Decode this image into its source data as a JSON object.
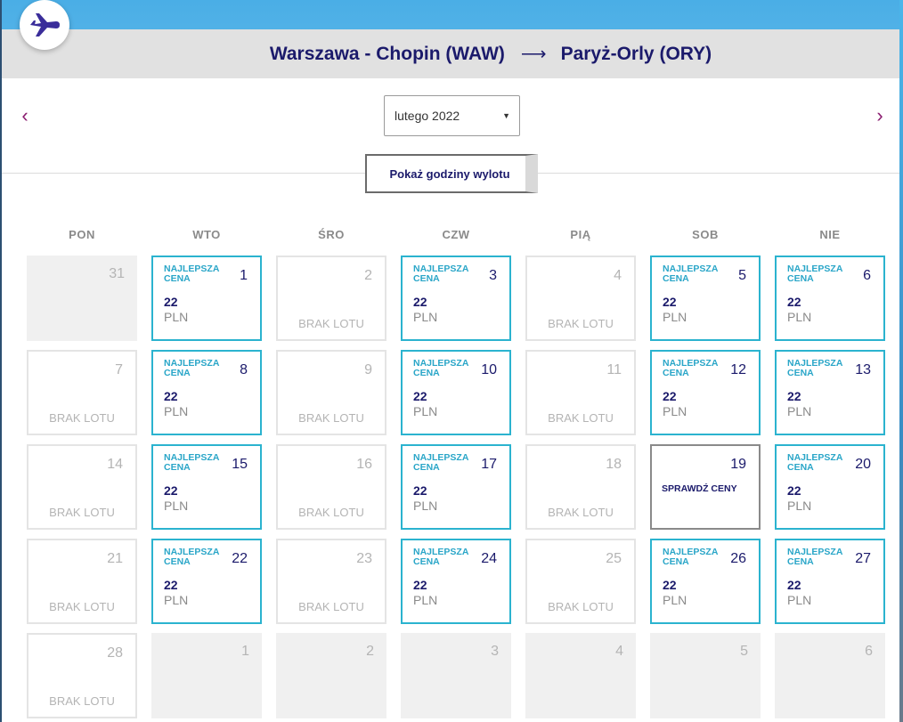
{
  "route": {
    "from": "Warszawa - Chopin (WAW)",
    "arrow": "⟶",
    "to": "Paryż-Orly (ORY)"
  },
  "nav": {
    "prev_icon": "chevron-left-icon",
    "next_icon": "chevron-right-icon",
    "prev_glyph": "‹",
    "next_glyph": "›"
  },
  "month_select": {
    "value": "lutego 2022",
    "caret": "▼"
  },
  "show_times_button": "Pokaż godziny wylotu",
  "weekdays": [
    "PON",
    "WTO",
    "ŚRO",
    "CZW",
    "PIĄ",
    "SOB",
    "NIE"
  ],
  "labels": {
    "best": "NAJLEPSZA CENA",
    "no_flight": "BRAK LOTU",
    "check_prices": "SPRAWDŹ CENY"
  },
  "colors": {
    "brand": "#1b1a6b",
    "best_border": "#2bb3cf",
    "nav_arrow": "#8a1c6f"
  },
  "days": [
    {
      "day": "31",
      "state": "past"
    },
    {
      "day": "1",
      "state": "best",
      "price": "22",
      "currency": "PLN"
    },
    {
      "day": "2",
      "state": "no_flight"
    },
    {
      "day": "3",
      "state": "best",
      "price": "22",
      "currency": "PLN"
    },
    {
      "day": "4",
      "state": "no_flight"
    },
    {
      "day": "5",
      "state": "best",
      "price": "22",
      "currency": "PLN"
    },
    {
      "day": "6",
      "state": "best",
      "price": "22",
      "currency": "PLN"
    },
    {
      "day": "7",
      "state": "no_flight"
    },
    {
      "day": "8",
      "state": "best",
      "price": "22",
      "currency": "PLN"
    },
    {
      "day": "9",
      "state": "no_flight"
    },
    {
      "day": "10",
      "state": "best",
      "price": "22",
      "currency": "PLN"
    },
    {
      "day": "11",
      "state": "no_flight"
    },
    {
      "day": "12",
      "state": "best",
      "price": "22",
      "currency": "PLN"
    },
    {
      "day": "13",
      "state": "best",
      "price": "22",
      "currency": "PLN"
    },
    {
      "day": "14",
      "state": "no_flight"
    },
    {
      "day": "15",
      "state": "best",
      "price": "22",
      "currency": "PLN"
    },
    {
      "day": "16",
      "state": "no_flight"
    },
    {
      "day": "17",
      "state": "best",
      "price": "22",
      "currency": "PLN"
    },
    {
      "day": "18",
      "state": "no_flight"
    },
    {
      "day": "19",
      "state": "check"
    },
    {
      "day": "20",
      "state": "best",
      "price": "22",
      "currency": "PLN"
    },
    {
      "day": "21",
      "state": "no_flight"
    },
    {
      "day": "22",
      "state": "best",
      "price": "22",
      "currency": "PLN"
    },
    {
      "day": "23",
      "state": "no_flight"
    },
    {
      "day": "24",
      "state": "best",
      "price": "22",
      "currency": "PLN"
    },
    {
      "day": "25",
      "state": "no_flight"
    },
    {
      "day": "26",
      "state": "best",
      "price": "22",
      "currency": "PLN"
    },
    {
      "day": "27",
      "state": "best",
      "price": "22",
      "currency": "PLN"
    },
    {
      "day": "28",
      "state": "no_flight"
    },
    {
      "day": "1",
      "state": "past"
    },
    {
      "day": "2",
      "state": "past"
    },
    {
      "day": "3",
      "state": "past"
    },
    {
      "day": "4",
      "state": "past"
    },
    {
      "day": "5",
      "state": "past"
    },
    {
      "day": "6",
      "state": "past"
    }
  ]
}
